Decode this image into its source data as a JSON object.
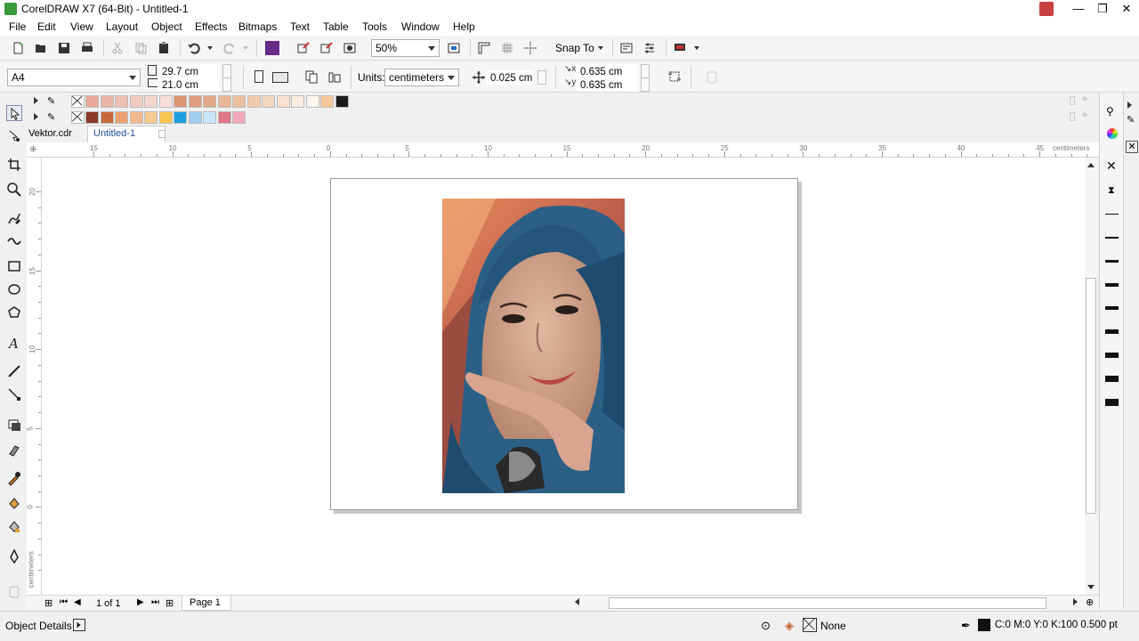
{
  "window": {
    "title": "CorelDRAW X7 (64-Bit) - Untitled-1",
    "minimize": "—",
    "restore": "❐",
    "close": "✕"
  },
  "menu": [
    "File",
    "Edit",
    "View",
    "Layout",
    "Object",
    "Effects",
    "Bitmaps",
    "Text",
    "Table",
    "Tools",
    "Window",
    "Help"
  ],
  "toolbar": {
    "zoom": "50%",
    "snap_to": "Snap To"
  },
  "property_bar": {
    "paper_size": "A4",
    "width": "29.7 cm",
    "height": "21.0 cm",
    "units_label": "Units:",
    "units_value": "centimeters",
    "nudge": "0.025 cm",
    "dup_x": "0.635 cm",
    "dup_y": "0.635 cm"
  },
  "palette": {
    "row1": [
      "#e8a898",
      "#eab4a6",
      "#efc0b4",
      "#f2cbc1",
      "#f4d6cd",
      "#f7e0d9",
      "#d99470",
      "#df9e7c",
      "#e3a988",
      "#e8b595",
      "#ecc0a2",
      "#f0cbb0",
      "#f4d7bf",
      "#f8e2cf",
      "#fbeee0",
      "#fdf6ee",
      "#f6c89a",
      "#1a1a1a"
    ],
    "row2": [
      "#8b3a2a",
      "#c8683a",
      "#eaa070",
      "#f2b890",
      "#f5ca90",
      "#f8c850",
      "#1aa0e0",
      "#9cd0f0",
      "#c8e6f8",
      "#e07888",
      "#f0a8b8"
    ]
  },
  "tabs": {
    "vektor": "Vektor.cdr",
    "untitled": "Untitled-1"
  },
  "ruler": {
    "unit": "centimeters",
    "h_labels": [
      "15",
      "10",
      "5",
      "0",
      "5",
      "10",
      "15",
      "20",
      "25",
      "30",
      "35",
      "40",
      "45"
    ],
    "v_labels": [
      "20",
      "15",
      "10",
      "5",
      "0"
    ]
  },
  "page_nav": {
    "page_count": "1 of 1",
    "page_tab": "Page 1"
  },
  "status": {
    "object_details": "Object Details",
    "fill": "None",
    "outline": "C:0 M:0 Y:0 K:100  0.500 pt"
  },
  "colors": {
    "accent": "#2a6ebb",
    "hijab": "#2b5f86",
    "active_tab": "#1f4f9e"
  }
}
